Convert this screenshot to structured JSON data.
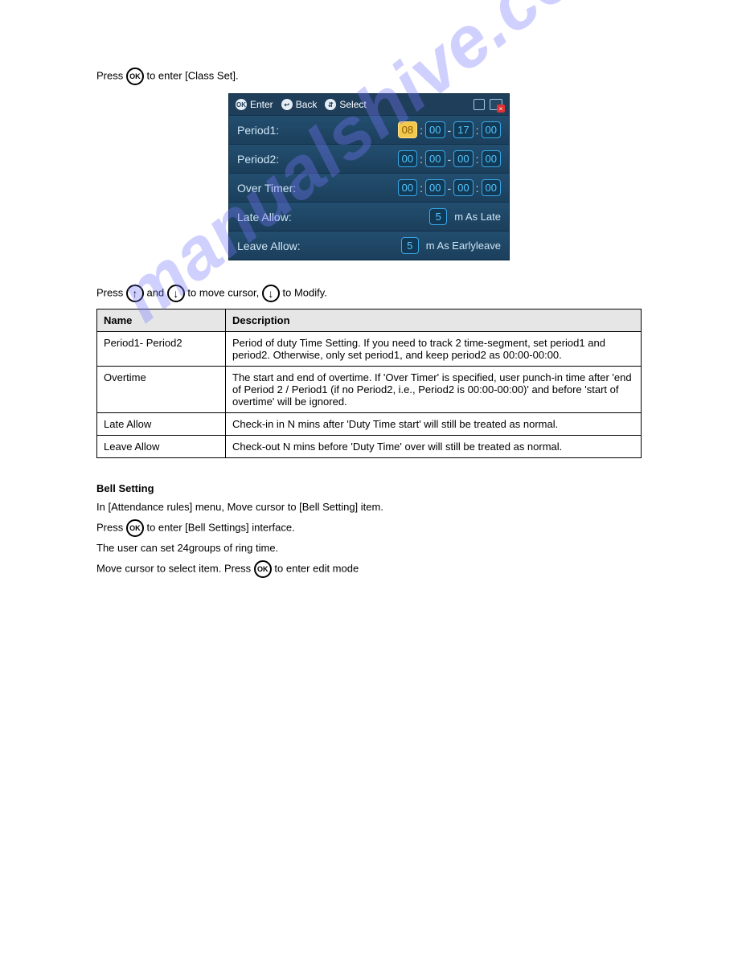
{
  "intro1_prefix": "Press ",
  "intro1_suffix": " to enter [Class Set].",
  "ok_label": "OK",
  "panel": {
    "enter": "Enter",
    "back": "Back",
    "select": "Select",
    "rows": {
      "period1": {
        "label": "Period1:",
        "h1": "08",
        "m1": "00",
        "h2": "17",
        "m2": "00"
      },
      "period2": {
        "label": "Period2:",
        "h1": "00",
        "m1": "00",
        "h2": "00",
        "m2": "00"
      },
      "over": {
        "label": "Over Timer:",
        "h1": "00",
        "m1": "00",
        "h2": "00",
        "m2": "00"
      },
      "late": {
        "label": "Late Allow:",
        "val": "5",
        "suffix": "m As Late"
      },
      "leave": {
        "label": "Leave Allow:",
        "val": "5",
        "suffix": "m As Earlyleave"
      }
    }
  },
  "instr2_prefix": "Press ",
  "instr2_mid1": " and ",
  "instr2_mid2": " to move cursor, ",
  "instr2_suffix": " to Modify.",
  "table": {
    "h1": "Name",
    "h2": "Description",
    "rows": [
      {
        "c1": "Period1- Period2",
        "c2": "Period of duty Time Setting. If you need to track 2 time-segment, set period1 and period2. Otherwise, only set period1, and keep period2 as 00:00-00:00."
      },
      {
        "c1": "Overtime",
        "c2": "The start and end of overtime. If 'Over Timer' is specified, user punch-in time after 'end of Period 2 / Period1 (if no Period2, i.e., Period2 is 00:00-00:00)' and before 'start of overtime' will be ignored."
      },
      {
        "c1": "Late Allow",
        "c2": "Check-in in N mins after 'Duty Time start' will still be treated as normal."
      },
      {
        "c1": "Leave Allow",
        "c2": "Check-out N mins before 'Duty Time' over will still be treated as normal."
      }
    ]
  },
  "bell": {
    "heading": "Bell Setting",
    "l1a": "In [Attendance rules] menu, Move cursor to [Bell Setting] item.",
    "l1b_prefix": "Press ",
    "l1b_suffix": " to enter [Bell Settings] interface.",
    "l2": "The user can set 24groups of ring time.",
    "l3_prefix": "Move cursor to select item. Press ",
    "l3_suffix": " to enter edit mode"
  }
}
